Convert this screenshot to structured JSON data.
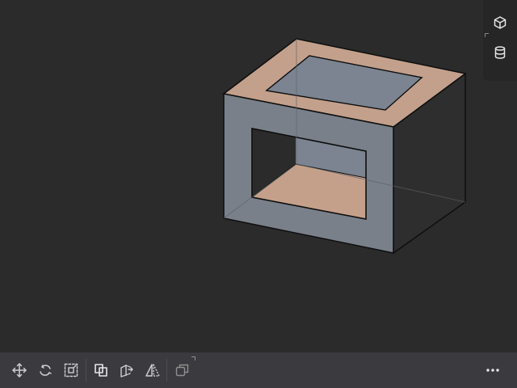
{
  "viewport": {
    "background": "#2b2b2b",
    "model": {
      "shape": "hollow-cube",
      "colors": {
        "front_face": "#7a808a",
        "top_face": "#c3a08c",
        "right_face": "#2e2e2e",
        "inner_floor": "#c4a08a",
        "inner_back": "#7b8490",
        "edge": "#0e0e0e",
        "hidden_edge": "#5a5f66"
      }
    }
  },
  "view_panel": {
    "buttons": [
      {
        "icon": "cube-icon"
      },
      {
        "icon": "cylinder-icon"
      }
    ]
  },
  "toolbar": {
    "background": "#3b3b3f",
    "tools": [
      {
        "icon": "move-icon"
      },
      {
        "icon": "rotate-icon"
      },
      {
        "icon": "scale-icon"
      },
      {
        "icon": "boolean-icon"
      },
      {
        "icon": "extrude-icon"
      },
      {
        "icon": "mirror-icon"
      },
      {
        "icon": "duplicate-icon"
      },
      {
        "icon": "more-icon"
      }
    ]
  }
}
